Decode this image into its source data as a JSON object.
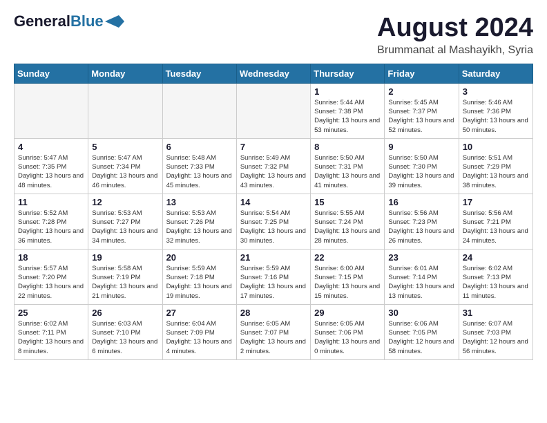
{
  "header": {
    "logo_general": "General",
    "logo_blue": "Blue",
    "month": "August 2024",
    "location": "Brummanat al Mashayikh, Syria"
  },
  "days_of_week": [
    "Sunday",
    "Monday",
    "Tuesday",
    "Wednesday",
    "Thursday",
    "Friday",
    "Saturday"
  ],
  "weeks": [
    [
      {
        "day": "",
        "info": ""
      },
      {
        "day": "",
        "info": ""
      },
      {
        "day": "",
        "info": ""
      },
      {
        "day": "",
        "info": ""
      },
      {
        "day": "1",
        "info": "Sunrise: 5:44 AM\nSunset: 7:38 PM\nDaylight: 13 hours\nand 53 minutes."
      },
      {
        "day": "2",
        "info": "Sunrise: 5:45 AM\nSunset: 7:37 PM\nDaylight: 13 hours\nand 52 minutes."
      },
      {
        "day": "3",
        "info": "Sunrise: 5:46 AM\nSunset: 7:36 PM\nDaylight: 13 hours\nand 50 minutes."
      }
    ],
    [
      {
        "day": "4",
        "info": "Sunrise: 5:47 AM\nSunset: 7:35 PM\nDaylight: 13 hours\nand 48 minutes."
      },
      {
        "day": "5",
        "info": "Sunrise: 5:47 AM\nSunset: 7:34 PM\nDaylight: 13 hours\nand 46 minutes."
      },
      {
        "day": "6",
        "info": "Sunrise: 5:48 AM\nSunset: 7:33 PM\nDaylight: 13 hours\nand 45 minutes."
      },
      {
        "day": "7",
        "info": "Sunrise: 5:49 AM\nSunset: 7:32 PM\nDaylight: 13 hours\nand 43 minutes."
      },
      {
        "day": "8",
        "info": "Sunrise: 5:50 AM\nSunset: 7:31 PM\nDaylight: 13 hours\nand 41 minutes."
      },
      {
        "day": "9",
        "info": "Sunrise: 5:50 AM\nSunset: 7:30 PM\nDaylight: 13 hours\nand 39 minutes."
      },
      {
        "day": "10",
        "info": "Sunrise: 5:51 AM\nSunset: 7:29 PM\nDaylight: 13 hours\nand 38 minutes."
      }
    ],
    [
      {
        "day": "11",
        "info": "Sunrise: 5:52 AM\nSunset: 7:28 PM\nDaylight: 13 hours\nand 36 minutes."
      },
      {
        "day": "12",
        "info": "Sunrise: 5:53 AM\nSunset: 7:27 PM\nDaylight: 13 hours\nand 34 minutes."
      },
      {
        "day": "13",
        "info": "Sunrise: 5:53 AM\nSunset: 7:26 PM\nDaylight: 13 hours\nand 32 minutes."
      },
      {
        "day": "14",
        "info": "Sunrise: 5:54 AM\nSunset: 7:25 PM\nDaylight: 13 hours\nand 30 minutes."
      },
      {
        "day": "15",
        "info": "Sunrise: 5:55 AM\nSunset: 7:24 PM\nDaylight: 13 hours\nand 28 minutes."
      },
      {
        "day": "16",
        "info": "Sunrise: 5:56 AM\nSunset: 7:23 PM\nDaylight: 13 hours\nand 26 minutes."
      },
      {
        "day": "17",
        "info": "Sunrise: 5:56 AM\nSunset: 7:21 PM\nDaylight: 13 hours\nand 24 minutes."
      }
    ],
    [
      {
        "day": "18",
        "info": "Sunrise: 5:57 AM\nSunset: 7:20 PM\nDaylight: 13 hours\nand 22 minutes."
      },
      {
        "day": "19",
        "info": "Sunrise: 5:58 AM\nSunset: 7:19 PM\nDaylight: 13 hours\nand 21 minutes."
      },
      {
        "day": "20",
        "info": "Sunrise: 5:59 AM\nSunset: 7:18 PM\nDaylight: 13 hours\nand 19 minutes."
      },
      {
        "day": "21",
        "info": "Sunrise: 5:59 AM\nSunset: 7:16 PM\nDaylight: 13 hours\nand 17 minutes."
      },
      {
        "day": "22",
        "info": "Sunrise: 6:00 AM\nSunset: 7:15 PM\nDaylight: 13 hours\nand 15 minutes."
      },
      {
        "day": "23",
        "info": "Sunrise: 6:01 AM\nSunset: 7:14 PM\nDaylight: 13 hours\nand 13 minutes."
      },
      {
        "day": "24",
        "info": "Sunrise: 6:02 AM\nSunset: 7:13 PM\nDaylight: 13 hours\nand 11 minutes."
      }
    ],
    [
      {
        "day": "25",
        "info": "Sunrise: 6:02 AM\nSunset: 7:11 PM\nDaylight: 13 hours\nand 8 minutes."
      },
      {
        "day": "26",
        "info": "Sunrise: 6:03 AM\nSunset: 7:10 PM\nDaylight: 13 hours\nand 6 minutes."
      },
      {
        "day": "27",
        "info": "Sunrise: 6:04 AM\nSunset: 7:09 PM\nDaylight: 13 hours\nand 4 minutes."
      },
      {
        "day": "28",
        "info": "Sunrise: 6:05 AM\nSunset: 7:07 PM\nDaylight: 13 hours\nand 2 minutes."
      },
      {
        "day": "29",
        "info": "Sunrise: 6:05 AM\nSunset: 7:06 PM\nDaylight: 13 hours\nand 0 minutes."
      },
      {
        "day": "30",
        "info": "Sunrise: 6:06 AM\nSunset: 7:05 PM\nDaylight: 12 hours\nand 58 minutes."
      },
      {
        "day": "31",
        "info": "Sunrise: 6:07 AM\nSunset: 7:03 PM\nDaylight: 12 hours\nand 56 minutes."
      }
    ]
  ]
}
